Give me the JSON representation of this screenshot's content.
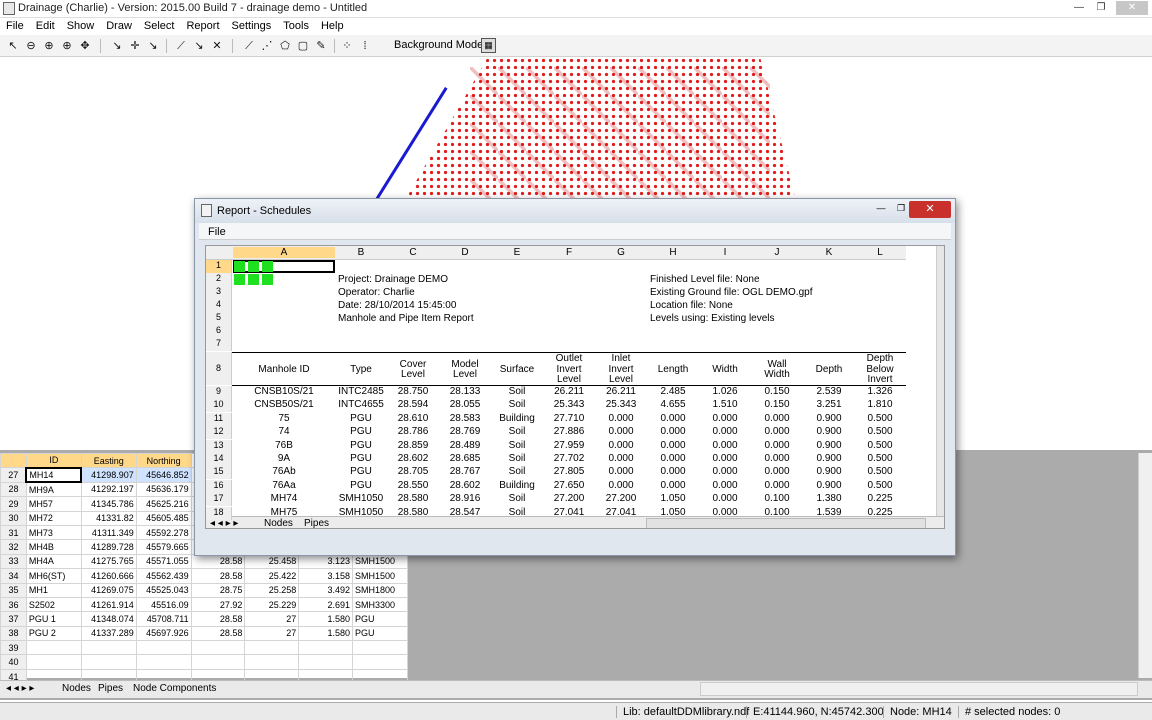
{
  "window": {
    "title": "Drainage (Charlie) - Version: 2015.00 Build 7 - drainage demo - Untitled",
    "min": "—",
    "max": "❐",
    "close": "✕"
  },
  "menu": [
    "File",
    "Edit",
    "Show",
    "Draw",
    "Select",
    "Report",
    "Settings",
    "Tools",
    "Help"
  ],
  "toolbar": {
    "background_models_label": "Background Models:"
  },
  "nodes_grid": {
    "columns": [
      "ID",
      "Easting",
      "Northing"
    ],
    "rows": [
      {
        "n": "27",
        "id": "MH14",
        "e": "41298.907",
        "nth": "45646.852",
        "c": "",
        "d": "",
        "f": "",
        "g": ""
      },
      {
        "n": "28",
        "id": "MH9A",
        "e": "41292.197",
        "nth": "45636.179",
        "c": "",
        "d": "",
        "f": "",
        "g": ""
      },
      {
        "n": "29",
        "id": "MH57",
        "e": "41345.786",
        "nth": "45625.216",
        "c": "",
        "d": "",
        "f": "",
        "g": ""
      },
      {
        "n": "30",
        "id": "MH72",
        "e": "41331.82",
        "nth": "45605.485",
        "c": "",
        "d": "",
        "f": "",
        "g": ""
      },
      {
        "n": "31",
        "id": "MH73",
        "e": "41311.349",
        "nth": "45592.278",
        "c": "",
        "d": "",
        "f": "",
        "g": ""
      },
      {
        "n": "32",
        "id": "MH4B",
        "e": "41289.728",
        "nth": "45579.665",
        "c": "",
        "d": "",
        "f": "",
        "g": ""
      },
      {
        "n": "33",
        "id": "MH4A",
        "e": "41275.765",
        "nth": "45571.055",
        "c": "28.58",
        "d": "25.458",
        "f": "3.123",
        "g": "SMH1500"
      },
      {
        "n": "34",
        "id": "MH6(ST)",
        "e": "41260.666",
        "nth": "45562.439",
        "c": "28.58",
        "d": "25.422",
        "f": "3.158",
        "g": "SMH1500"
      },
      {
        "n": "35",
        "id": "MH1",
        "e": "41269.075",
        "nth": "45525.043",
        "c": "28.75",
        "d": "25.258",
        "f": "3.492",
        "g": "SMH1800"
      },
      {
        "n": "36",
        "id": "S2502",
        "e": "41261.914",
        "nth": "45516.09",
        "c": "27.92",
        "d": "25.229",
        "f": "2.691",
        "g": "SMH3300"
      },
      {
        "n": "37",
        "id": "PGU 1",
        "e": "41348.074",
        "nth": "45708.711",
        "c": "28.58",
        "d": "27",
        "f": "1.580",
        "g": "PGU"
      },
      {
        "n": "38",
        "id": "PGU 2",
        "e": "41337.289",
        "nth": "45697.926",
        "c": "28.58",
        "d": "27",
        "f": "1.580",
        "g": "PGU"
      },
      {
        "n": "39",
        "id": "",
        "e": "",
        "nth": "",
        "c": "",
        "d": "",
        "f": "",
        "g": ""
      },
      {
        "n": "40",
        "id": "",
        "e": "",
        "nth": "",
        "c": "",
        "d": "",
        "f": "",
        "g": ""
      },
      {
        "n": "41",
        "id": "",
        "e": "",
        "nth": "",
        "c": "",
        "d": "",
        "f": "",
        "g": ""
      }
    ]
  },
  "bottom_tabs": [
    "Nodes",
    "Pipes",
    "Node Components"
  ],
  "status": {
    "lib": "Lib: defaultDDMlibrary.ndf",
    "coords": "E:41144.960, N:45742.300",
    "node": "Node: MH14",
    "selected": "# selected nodes: 0"
  },
  "dialog": {
    "title": "Report - Schedules",
    "menu": "File",
    "col_letters": [
      "A",
      "B",
      "C",
      "D",
      "E",
      "F",
      "G",
      "H",
      "I",
      "J",
      "K",
      "L"
    ],
    "info": {
      "project": "Project: Drainage DEMO",
      "operator": "Operator: Charlie",
      "date": "Date: 28/10/2014 15:45:00",
      "report": "Manhole and Pipe Item Report",
      "finished": "Finished Level file: None",
      "ground": "Existing Ground file: OGL DEMO.gpf",
      "location": "Location file: None",
      "levels": "Levels using: Existing levels"
    },
    "headers": [
      "Manhole ID",
      "Type",
      "Cover\nLevel",
      "Model\nLevel",
      "Surface",
      "Outlet\nInvert\nLevel",
      "Inlet\nInvert\nLevel",
      "Length",
      "Width",
      "Wall\nWidth",
      "Depth",
      "Depth\nBelow\nInvert"
    ],
    "rows": [
      [
        "9",
        "CNSB10S/21",
        "INTC2485",
        "28.750",
        "28.133",
        "Soil",
        "26.211",
        "26.211",
        "2.485",
        "1.026",
        "0.150",
        "2.539",
        "1.326"
      ],
      [
        "10",
        "CNSB50S/21",
        "INTC4655",
        "28.594",
        "28.055",
        "Soil",
        "25.343",
        "25.343",
        "4.655",
        "1.510",
        "0.150",
        "3.251",
        "1.810"
      ],
      [
        "11",
        "75",
        "PGU",
        "28.610",
        "28.583",
        "Building",
        "27.710",
        "0.000",
        "0.000",
        "0.000",
        "0.000",
        "0.900",
        "0.500"
      ],
      [
        "12",
        "74",
        "PGU",
        "28.786",
        "28.769",
        "Soil",
        "27.886",
        "0.000",
        "0.000",
        "0.000",
        "0.000",
        "0.900",
        "0.500"
      ],
      [
        "13",
        "76B",
        "PGU",
        "28.859",
        "28.489",
        "Soil",
        "27.959",
        "0.000",
        "0.000",
        "0.000",
        "0.000",
        "0.900",
        "0.500"
      ],
      [
        "14",
        "9A",
        "PGU",
        "28.602",
        "28.685",
        "Soil",
        "27.702",
        "0.000",
        "0.000",
        "0.000",
        "0.000",
        "0.900",
        "0.500"
      ],
      [
        "15",
        "76Ab",
        "PGU",
        "28.705",
        "28.767",
        "Soil",
        "27.805",
        "0.000",
        "0.000",
        "0.000",
        "0.000",
        "0.900",
        "0.500"
      ],
      [
        "16",
        "76Aa",
        "PGU",
        "28.550",
        "28.602",
        "Building",
        "27.650",
        "0.000",
        "0.000",
        "0.000",
        "0.000",
        "0.900",
        "0.500"
      ],
      [
        "17",
        "MH74",
        "SMH1050",
        "28.580",
        "28.916",
        "Soil",
        "27.200",
        "27.200",
        "1.050",
        "0.000",
        "0.100",
        "1.380",
        "0.225"
      ],
      [
        "18",
        "MH75",
        "SMH1050",
        "28.580",
        "28.547",
        "Soil",
        "27.041",
        "27.041",
        "1.050",
        "0.000",
        "0.100",
        "1.539",
        "0.225"
      ]
    ],
    "tabs": [
      "Nodes",
      "Pipes"
    ]
  }
}
